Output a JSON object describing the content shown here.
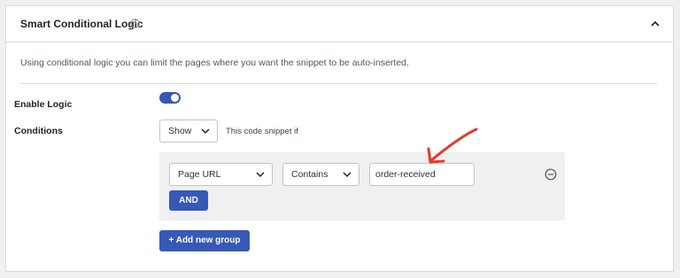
{
  "panel": {
    "title": "Smart Conditional Logic",
    "description": "Using conditional logic you can limit the pages where you want the snippet to be auto-inserted."
  },
  "enable_logic": {
    "label": "Enable Logic",
    "enabled": true
  },
  "conditions": {
    "label": "Conditions",
    "mode_select": "Show",
    "helper_text": "This code snippet if",
    "group": {
      "field_select": "Page URL",
      "operator_select": "Contains",
      "value": "order-received",
      "and_button": "AND"
    },
    "add_group_button": "+ Add new group"
  },
  "colors": {
    "accent": "#3858b8",
    "annotation_arrow": "#e23b2e"
  },
  "icons": [
    "help-icon",
    "chevron-up-icon",
    "chevron-down-icon",
    "remove-circle-icon",
    "annotation-arrow-icon"
  ]
}
